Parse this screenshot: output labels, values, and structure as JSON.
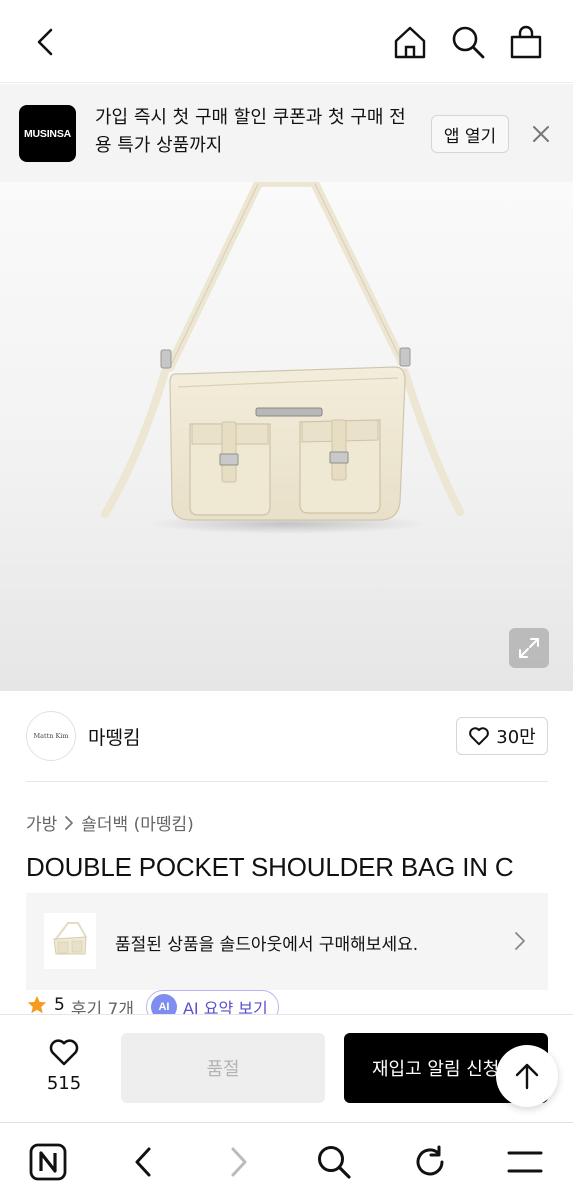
{
  "banner": {
    "logo_text": "MUSINSA",
    "message": "가입 즉시 첫 구매 할인 쿠폰과 첫 구매 전용 특가 상품까지",
    "open_app_label": "앱 열기"
  },
  "brand": {
    "avatar_text": "Mattn Kim",
    "name": "마뗑킴",
    "likes": "30만"
  },
  "breadcrumb": {
    "category": "가방",
    "subcategory": "숄더백 (마뗑킴)"
  },
  "product": {
    "title": "DOUBLE POCKET SHOULDER BAG IN C"
  },
  "soldout_banner": {
    "text": "품절된 상품을 솔드아웃에서 구매해보세요."
  },
  "rating": {
    "score": "5",
    "reviews": "후기 7개",
    "ai_badge": "AI",
    "ai_label": "AI 요약 보기"
  },
  "actions": {
    "wish_count": "515",
    "soldout_label": "품절",
    "restock_label": "재입고 알림 신청"
  },
  "colors": {
    "accent_ai": "#5a4fcf",
    "star": "#f59a23",
    "primary_button": "#000000"
  }
}
